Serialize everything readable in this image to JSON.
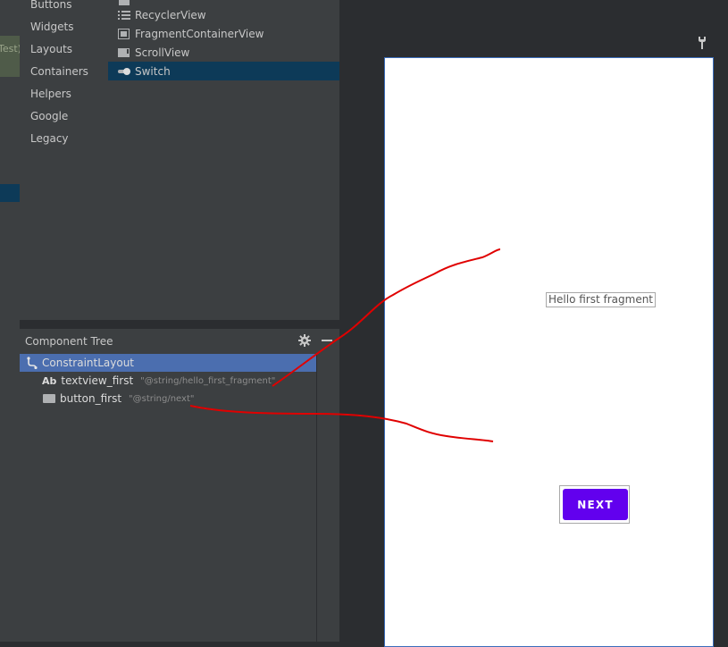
{
  "left_strip": {
    "partial_label": "Test)"
  },
  "palette": {
    "categories": [
      "Buttons",
      "Widgets",
      "Layouts",
      "Containers",
      "Helpers",
      "Google",
      "Legacy"
    ],
    "widgets": [
      {
        "label": "RecyclerView",
        "icon": "list-icon"
      },
      {
        "label": "FragmentContainerView",
        "icon": "fragment-icon"
      },
      {
        "label": "ScrollView",
        "icon": "scrollview-icon"
      },
      {
        "label": "Switch",
        "icon": "switch-icon",
        "selected": true
      }
    ]
  },
  "component_tree": {
    "title": "Component Tree",
    "root": {
      "label": "ConstraintLayout",
      "icon": "constraint-layout-icon"
    },
    "children": [
      {
        "prefix": "Ab",
        "label": "textview_first",
        "attr": "\"@string/hello_first_fragment\"",
        "icon": "textview-icon"
      },
      {
        "prefix": "",
        "label": "button_first",
        "attr": "\"@string/next\"",
        "icon": "button-icon"
      }
    ]
  },
  "canvas": {
    "textview_text": "Hello first fragment",
    "button_text": "NEXT"
  },
  "colors": {
    "button_primary": "#6200ee",
    "selection": "#4b6eaf",
    "annotation": "#e00000"
  }
}
